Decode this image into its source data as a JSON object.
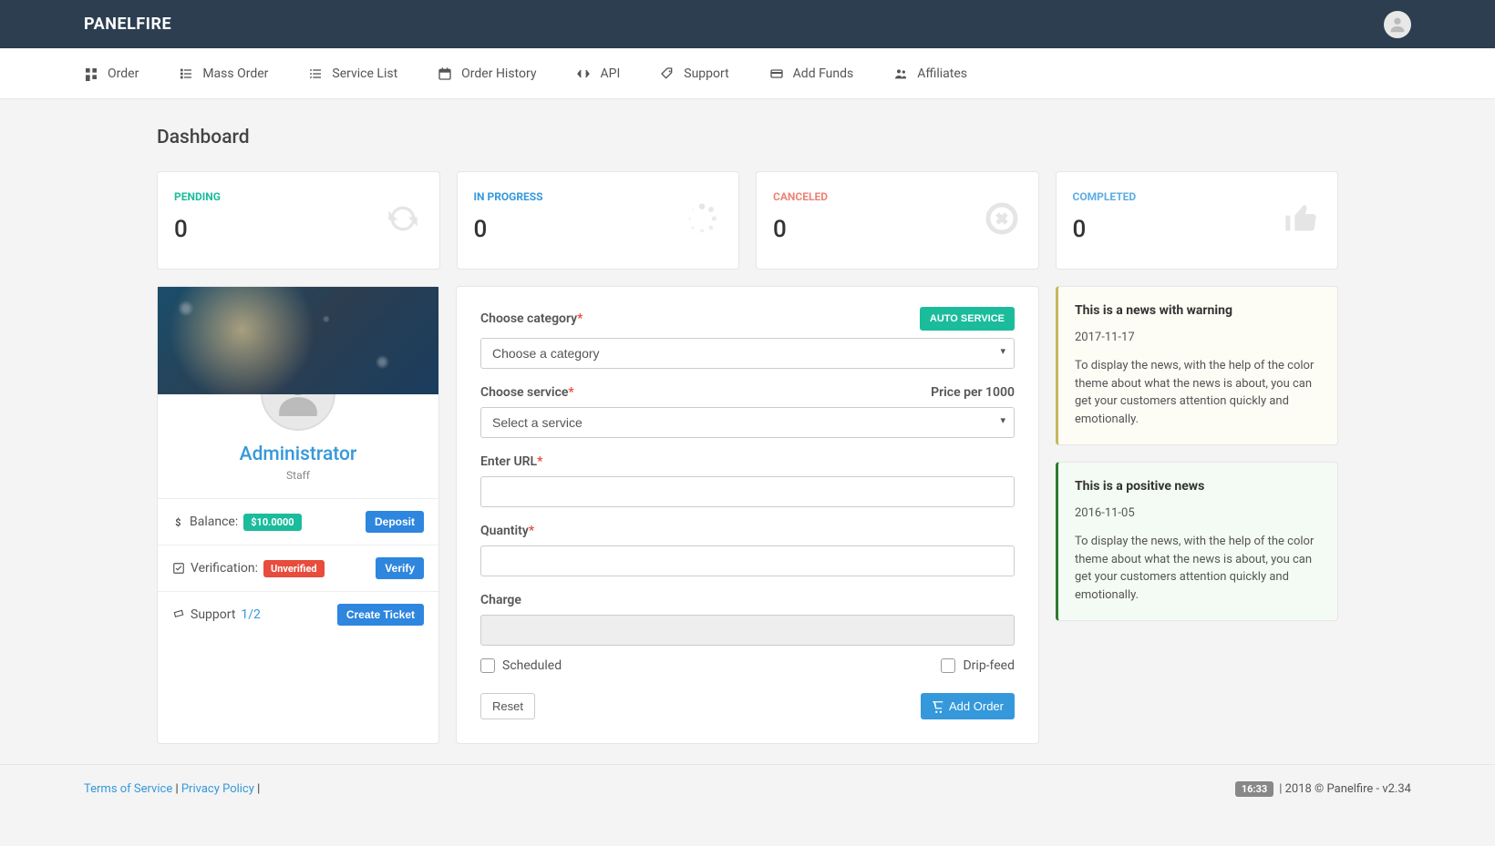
{
  "brand": "PANELFIRE",
  "nav": [
    {
      "label": "Order",
      "icon": "grid"
    },
    {
      "label": "Mass Order",
      "icon": "list"
    },
    {
      "label": "Service List",
      "icon": "lines"
    },
    {
      "label": "Order History",
      "icon": "calendar"
    },
    {
      "label": "API",
      "icon": "code"
    },
    {
      "label": "Support",
      "icon": "tag"
    },
    {
      "label": "Add Funds",
      "icon": "card"
    },
    {
      "label": "Affiliates",
      "icon": "users"
    }
  ],
  "page_title": "Dashboard",
  "stats": {
    "pending": {
      "label": "PENDING",
      "value": "0"
    },
    "in_progress": {
      "label": "IN PROGRESS",
      "value": "0"
    },
    "canceled": {
      "label": "CANCELED",
      "value": "0"
    },
    "completed": {
      "label": "COMPLETED",
      "value": "0"
    }
  },
  "profile": {
    "name": "Administrator",
    "role": "Staff",
    "balance_label": "Balance:",
    "balance_value": "$10.0000",
    "deposit_btn": "Deposit",
    "verification_label": "Verification:",
    "verification_status": "Unverified",
    "verify_btn": "Verify",
    "support_label": "Support ",
    "support_count": "1/2",
    "create_ticket_btn": "Create Ticket"
  },
  "order_form": {
    "auto_service_btn": "AUTO SERVICE",
    "category_label": "Choose category",
    "category_placeholder": "Choose a category",
    "service_label": "Choose service",
    "service_placeholder": "Select a service",
    "price_label": "Price per 1000",
    "url_label": "Enter URL",
    "quantity_label": "Quantity",
    "charge_label": "Charge",
    "scheduled_label": "Scheduled",
    "dripfeed_label": "Drip-feed",
    "reset_btn": "Reset",
    "add_order_btn": "Add Order"
  },
  "news": [
    {
      "type": "warning",
      "title": "This is a news with warning",
      "date": "2017-11-17",
      "body": "To display the news, with the help of the color theme about what the news is about, you can get your customers attention quickly and emotionally."
    },
    {
      "type": "positive",
      "title": "This is a positive news",
      "date": "2016-11-05",
      "body": "To display the news, with the help of the color theme about what the news is about, you can get your customers attention quickly and emotionally."
    }
  ],
  "footer": {
    "tos": "Terms of Service",
    "pp": "Privacy Policy",
    "time": "16:33",
    "copyright": " | 2018 © Panelfire - v2.34"
  }
}
